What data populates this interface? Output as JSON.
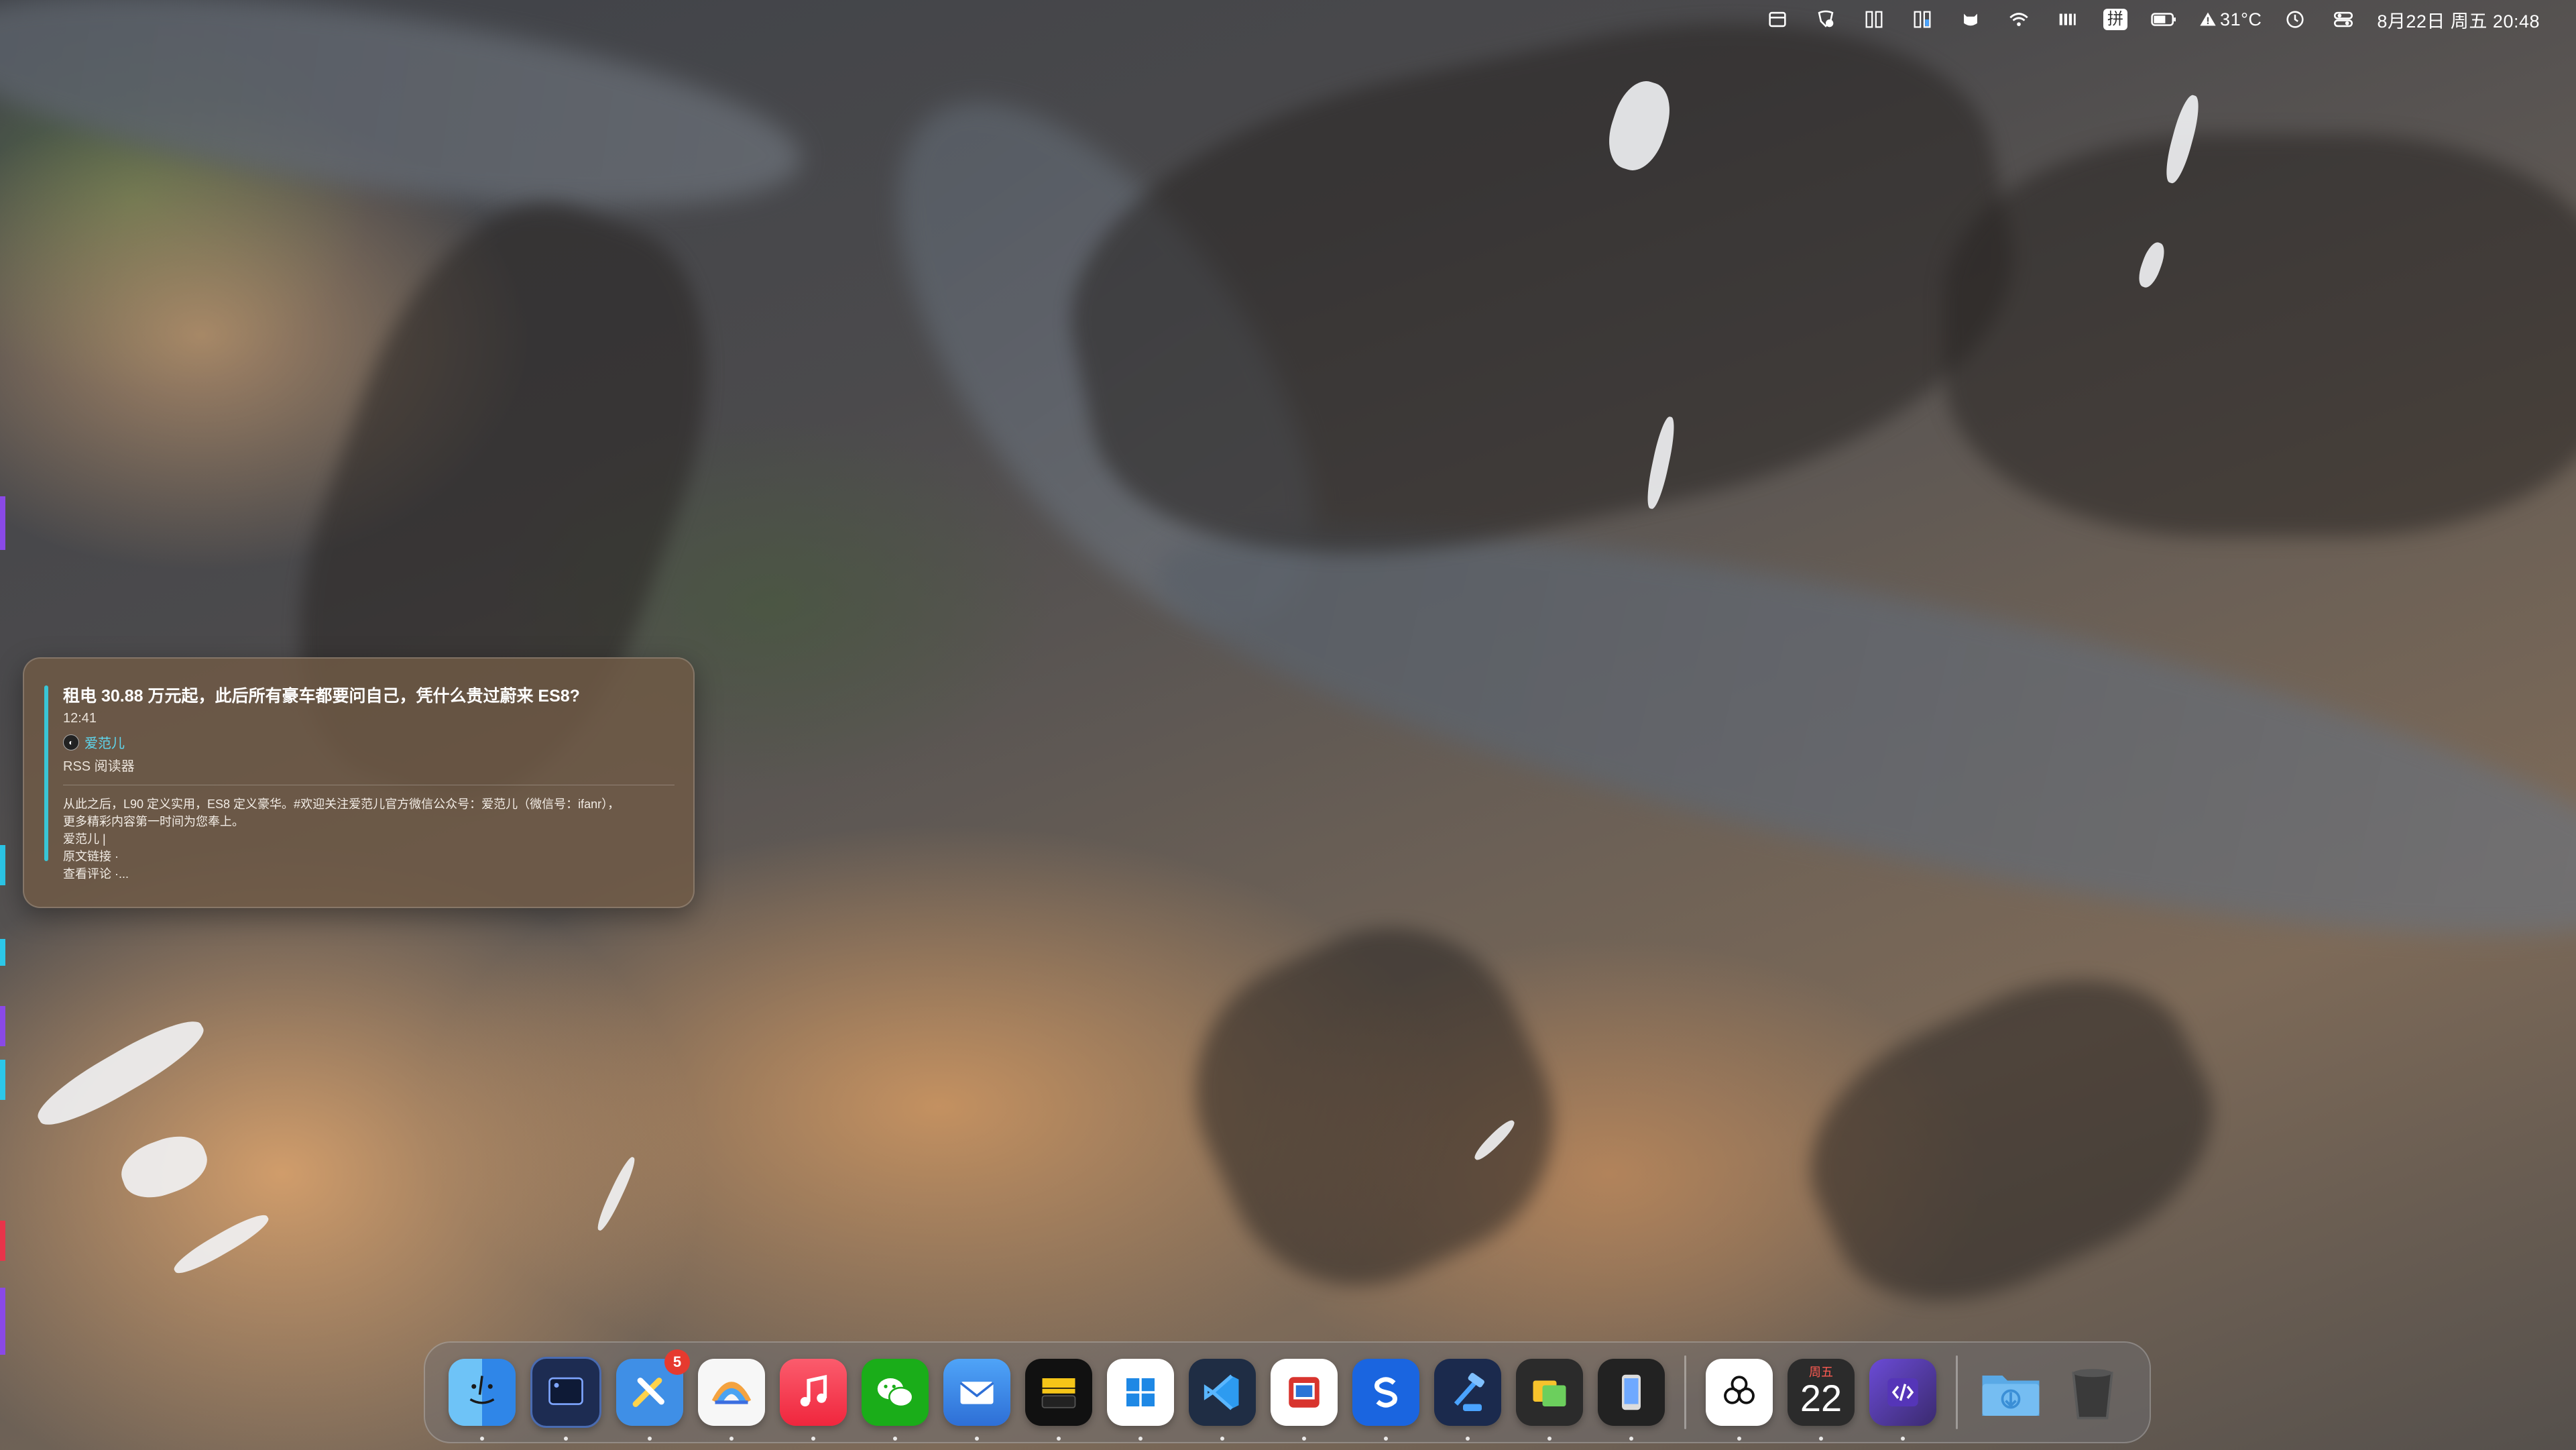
{
  "menubar": {
    "temperature": "31°C",
    "datetime": "8月22日 周五  20:48",
    "input_method": "拼"
  },
  "notification": {
    "title": "租电 30.88 万元起，此后所有豪车都要问自己，凭什么贵过蔚来 ES8?",
    "time": "12:41",
    "source": "爱范儿",
    "app": "RSS 阅读器",
    "body_lines": [
      "从此之后，L90 定义实用，ES8 定义豪华。#欢迎关注爱范儿官方微信公众号：爱范儿（微信号：ifanr），",
      "更多精彩内容第一时间为您奉上。",
      "爱范儿 |",
      "原文链接 ·",
      "查看评论 ·..."
    ]
  },
  "dock": {
    "items": [
      {
        "name": "finder",
        "bg": "#2f86e8"
      },
      {
        "name": "terminal-app",
        "bg": "#1d2c52"
      },
      {
        "name": "xcode-tools",
        "bg": "#3f8fe6",
        "badge": "5"
      },
      {
        "name": "arc-browser",
        "bg": "#f7f7f7"
      },
      {
        "name": "music",
        "bg": "#f63a48"
      },
      {
        "name": "wechat",
        "bg": "#1aad19"
      },
      {
        "name": "mail",
        "bg": "#3c6fd6"
      },
      {
        "name": "wallet",
        "bg": "#111111"
      },
      {
        "name": "windows-app",
        "bg": "#ffffff"
      },
      {
        "name": "vscode",
        "bg": "#1f2d44"
      },
      {
        "name": "microsoft-remote",
        "bg": "#ffffff"
      },
      {
        "name": "sketch-s",
        "bg": "#1a65e0"
      },
      {
        "name": "xcode-beta",
        "bg": "#1b2a4d"
      },
      {
        "name": "files-folder",
        "bg": "#2b2b2b"
      },
      {
        "name": "ios-simulator",
        "bg": "#222222"
      },
      {
        "name": "chatgpt",
        "bg": "#ffffff"
      },
      {
        "name": "calendar",
        "bg": "#2b2b2b",
        "weekday": "周五",
        "day": "22"
      },
      {
        "name": "dev-tools",
        "bg": "#3a2a6e"
      },
      {
        "name": "downloads-folder",
        "bg": "#5aa9e6"
      },
      {
        "name": "trash",
        "bg": "#3a3a3a"
      }
    ]
  }
}
